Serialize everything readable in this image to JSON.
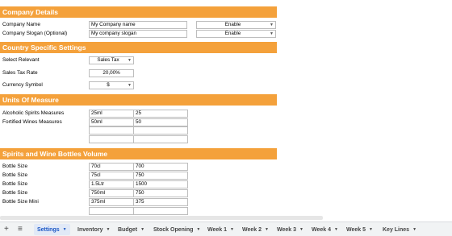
{
  "sections": {
    "company": "Company Details",
    "country": "Country Specific Settings",
    "units": "Units Of Measure",
    "bottles": "Spirits and Wine Bottles Volume"
  },
  "company": {
    "name_label": "Company Name",
    "name_value": "My Company name",
    "name_toggle": "Enable",
    "slogan_label": "Company Slogan (Optional)",
    "slogan_value": "My company slogan",
    "slogan_toggle": "Enable"
  },
  "country": {
    "relevant_label": "Select Relevant",
    "relevant_value": "Sales Tax",
    "rate_label": "Sales Tax Rate",
    "rate_value": "20,00%",
    "currency_label": "Currency Symbol",
    "currency_value": "$"
  },
  "units": {
    "rows": [
      {
        "label": "Alcoholic Spirits Measures",
        "a": "25ml",
        "b": "25"
      },
      {
        "label": "Fortified Wines Measures",
        "a": "50ml",
        "b": "50"
      },
      {
        "label": "",
        "a": "",
        "b": ""
      },
      {
        "label": "",
        "a": "",
        "b": ""
      }
    ]
  },
  "bottles": {
    "rows": [
      {
        "label": "Bottle Size",
        "a": "70cl",
        "b": "700"
      },
      {
        "label": "Bottle Size",
        "a": "75cl",
        "b": "750"
      },
      {
        "label": "Bottle Size",
        "a": "1.5Ltr",
        "b": "1500"
      },
      {
        "label": "Bottle Size",
        "a": "750ml",
        "b": "750"
      },
      {
        "label": "Bottle Size Mini",
        "a": "375ml",
        "b": "375"
      },
      {
        "label": "",
        "a": "",
        "b": ""
      }
    ]
  },
  "tabs": {
    "add_icon": "+",
    "menu_icon": "≡",
    "items": [
      "Settings",
      "Inventory",
      "Budget",
      "Stock Opening",
      "Week 1",
      "Week 2",
      "Week 3",
      "Week 4",
      "Week 5",
      "Key Lines"
    ]
  },
  "colors": {
    "header": "#f4a13b",
    "active_tab": "#1a56c4"
  },
  "icons": {
    "dropdown": "chevron-down-icon",
    "add": "add-sheet-icon",
    "menu": "all-sheets-icon"
  }
}
